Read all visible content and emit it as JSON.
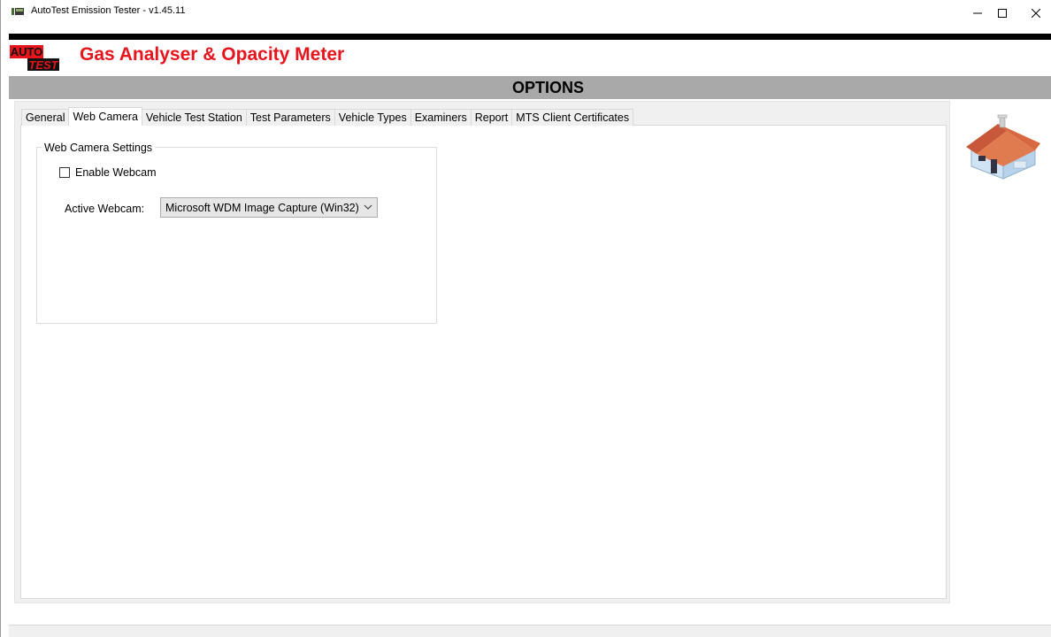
{
  "window": {
    "title": "AutoTest Emission Tester - v1.45.11",
    "controls": {
      "minimize": "—",
      "maximize": "☐",
      "close": "✕"
    }
  },
  "header": {
    "logo_line1": "AUTO",
    "logo_line2": "TEST",
    "app_title": "Gas Analyser & Opacity Meter",
    "brand_color": "#e8141c"
  },
  "page": {
    "title": "OPTIONS"
  },
  "tabs": [
    {
      "label": "General",
      "active": false
    },
    {
      "label": "Web Camera",
      "active": true
    },
    {
      "label": "Vehicle Test Station",
      "active": false
    },
    {
      "label": "Test Parameters",
      "active": false
    },
    {
      "label": "Vehicle Types",
      "active": false
    },
    {
      "label": "Examiners",
      "active": false
    },
    {
      "label": "Report",
      "active": false
    },
    {
      "label": "MTS Client Certificates",
      "active": false
    }
  ],
  "webcam_settings": {
    "group_title": "Web Camera Settings",
    "enable_label": "Enable Webcam",
    "enable_checked": false,
    "active_label": "Active Webcam:",
    "active_value": "Microsoft WDM Image Capture (Win32)"
  },
  "icons": {
    "home": "home-icon",
    "app": "app-icon"
  }
}
